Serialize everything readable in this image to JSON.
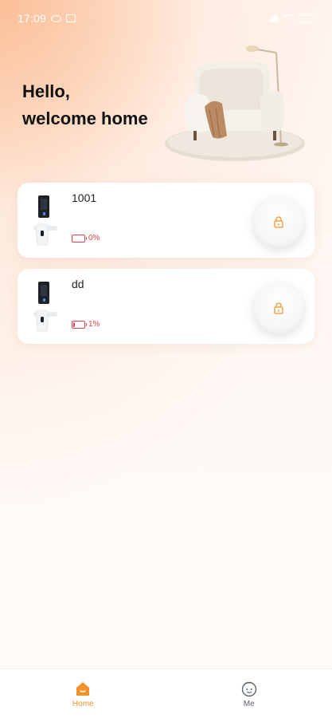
{
  "status_bar": {
    "time": "17:09",
    "icons": [
      "eye-icon",
      "image-icon",
      "signal-icon",
      "wifi-icon",
      "battery-icon"
    ]
  },
  "header": {
    "greeting_line1": "Hello,",
    "greeting_line2": "welcome home",
    "hero_image": "armchair-with-floor-lamp"
  },
  "devices": [
    {
      "name": "1001",
      "battery_level": 0,
      "battery_label": "0%",
      "action_icon": "unlock-icon"
    },
    {
      "name": "dd",
      "battery_level": 1,
      "battery_label": "1%",
      "action_icon": "unlock-icon"
    }
  ],
  "bottom_nav": {
    "items": [
      {
        "label": "Home",
        "icon": "home-icon",
        "active": true
      },
      {
        "label": "Me",
        "icon": "face-icon",
        "active": false
      }
    ]
  },
  "colors": {
    "accent": "#f0932b",
    "battery_low": "#e0424b",
    "text_dark": "#111111"
  }
}
